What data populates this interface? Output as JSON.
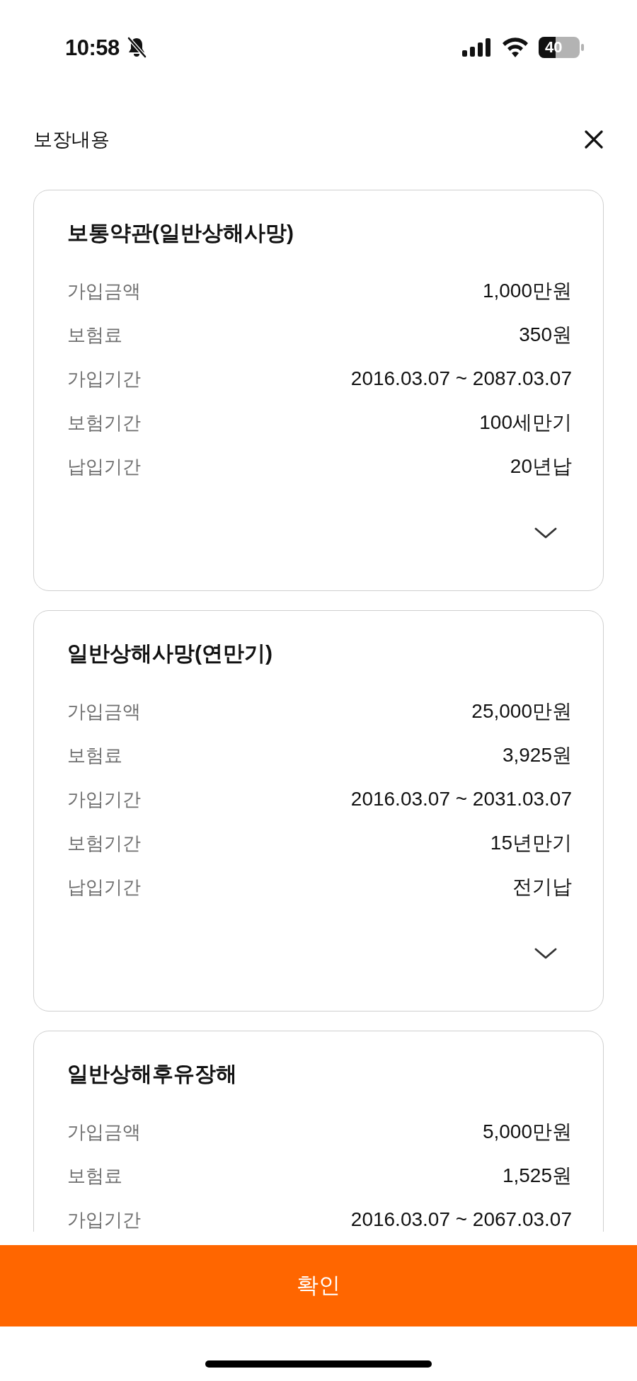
{
  "status_bar": {
    "time": "10:58",
    "battery": "40"
  },
  "header": {
    "title": "보장내용"
  },
  "cards": [
    {
      "title": "보통약관(일반상해사망)",
      "rows": [
        {
          "label": "가입금액",
          "value": "1,000만원"
        },
        {
          "label": "보험료",
          "value": "350원"
        },
        {
          "label": "가입기간",
          "value": "2016.03.07 ~ 2087.03.07"
        },
        {
          "label": "보험기간",
          "value": "100세만기"
        },
        {
          "label": "납입기간",
          "value": "20년납"
        }
      ],
      "expanded": false
    },
    {
      "title": "일반상해사망(연만기)",
      "rows": [
        {
          "label": "가입금액",
          "value": "25,000만원"
        },
        {
          "label": "보험료",
          "value": "3,925원"
        },
        {
          "label": "가입기간",
          "value": "2016.03.07 ~ 2031.03.07"
        },
        {
          "label": "보험기간",
          "value": "15년만기"
        },
        {
          "label": "납입기간",
          "value": "전기납"
        }
      ],
      "expanded": false
    },
    {
      "title": "일반상해후유장해",
      "rows": [
        {
          "label": "가입금액",
          "value": "5,000만원"
        },
        {
          "label": "보험료",
          "value": "1,525원"
        },
        {
          "label": "가입기간",
          "value": "2016.03.07 ~ 2067.03.07"
        }
      ]
    }
  ],
  "confirm_button": {
    "label": "확인"
  }
}
